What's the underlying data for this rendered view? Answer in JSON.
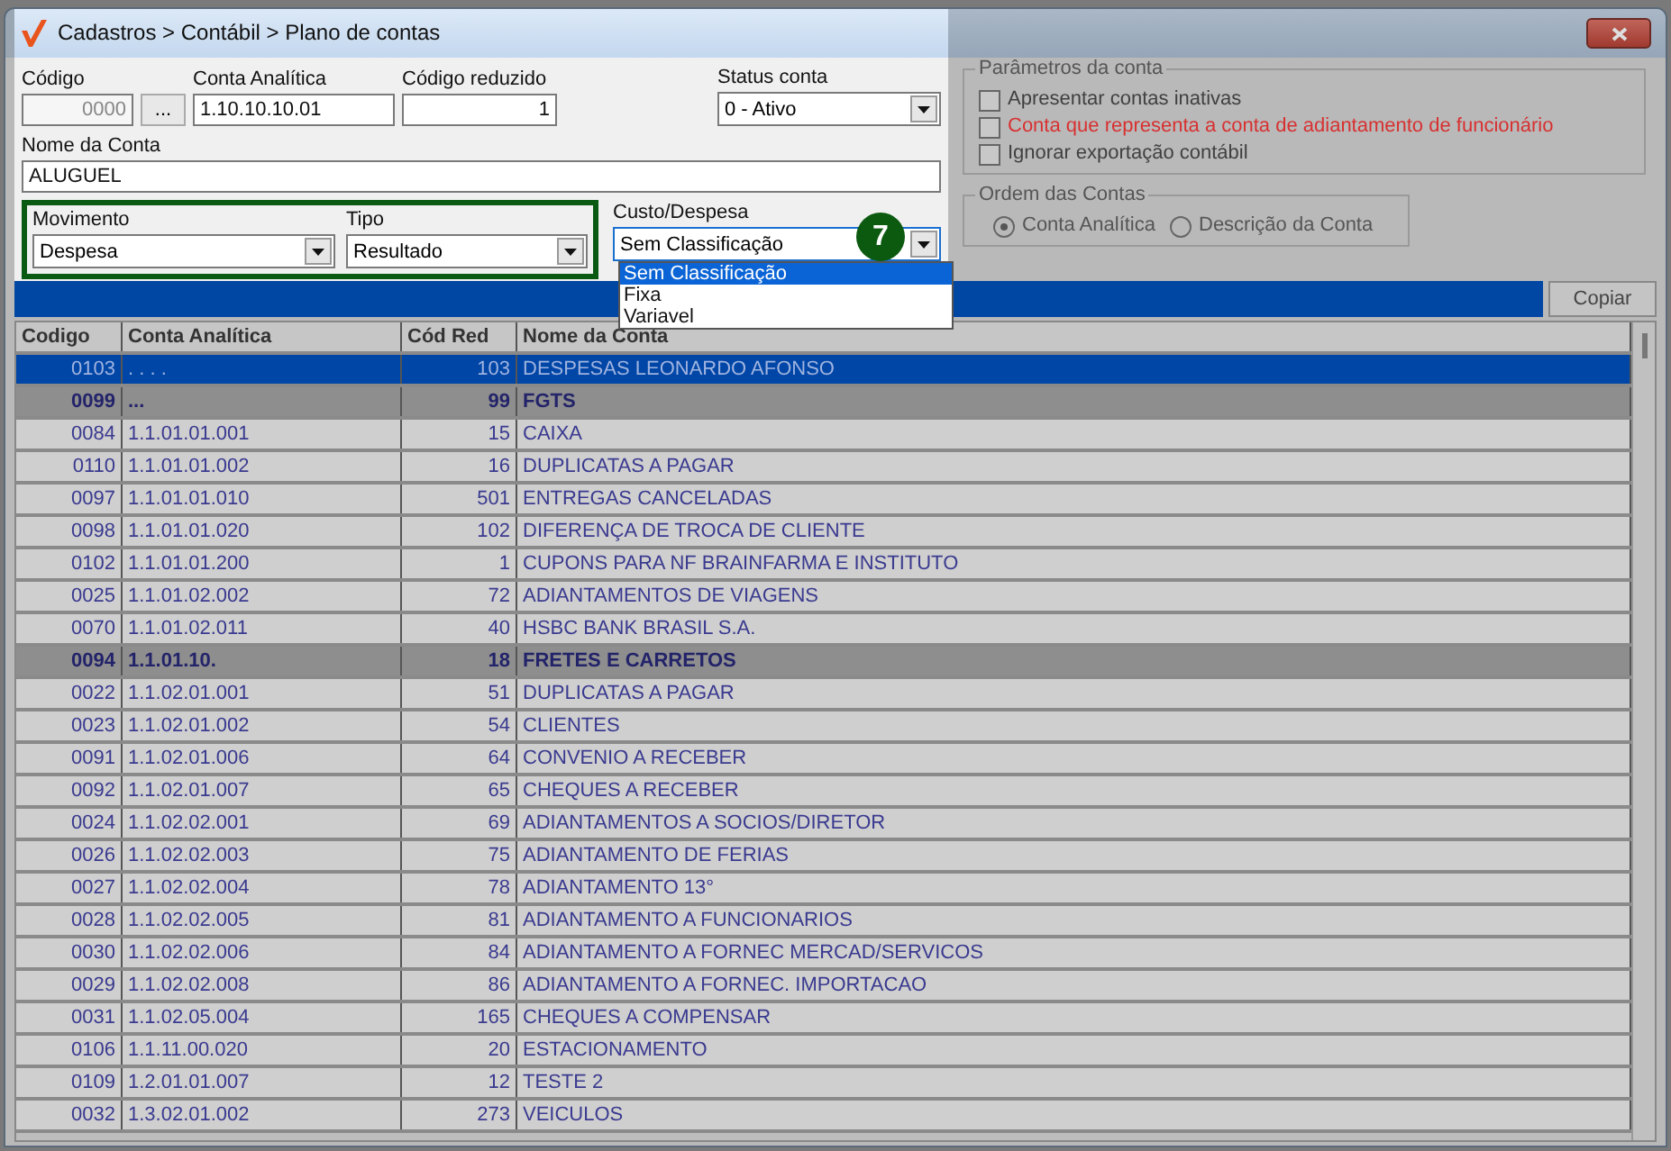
{
  "window": {
    "title": "Cadastros > Contábil > Plano de contas"
  },
  "form": {
    "codigo": {
      "label": "Código",
      "value": "0000",
      "disabled": true,
      "lookup_button": "..."
    },
    "conta_analitica": {
      "label": "Conta Analítica",
      "value": "1.10.10.10.01"
    },
    "codigo_reduzido": {
      "label": "Código reduzido",
      "value": "1"
    },
    "status_conta": {
      "label": "Status conta",
      "value": "0 - Ativo"
    },
    "nome_da_conta": {
      "label": "Nome da Conta",
      "value": "ALUGUEL"
    },
    "movimento": {
      "label": "Movimento",
      "value": "Despesa"
    },
    "tipo": {
      "label": "Tipo",
      "value": "Resultado"
    },
    "custo_despesa": {
      "label": "Custo/Despesa",
      "value": "Sem Classificação",
      "expanded": true,
      "options": [
        {
          "label": "Sem Classificação",
          "selected": true
        },
        {
          "label": "Fixa",
          "selected": false
        },
        {
          "label": "Variavel",
          "selected": false
        }
      ]
    }
  },
  "callout": "7",
  "parametros": {
    "title": "Parâmetros da conta",
    "options": [
      {
        "label": "Apresentar contas inativas",
        "checked": false,
        "color": "#404040"
      },
      {
        "label": "Conta que representa a conta de adiantamento de funcionário",
        "checked": false,
        "color": "#d83030"
      },
      {
        "label": "Ignorar exportação contábil",
        "checked": false,
        "color": "#404040"
      }
    ]
  },
  "ordem": {
    "title": "Ordem das Contas",
    "options": [
      {
        "label": "Conta Analítica",
        "selected": true
      },
      {
        "label": "Descrição da Conta",
        "selected": false
      }
    ]
  },
  "copy_button": "Copiar",
  "table": {
    "columns": [
      "Codigo",
      "Conta Analítica",
      "Cód Red",
      "Nome da Conta"
    ],
    "rows": [
      {
        "kind": "account",
        "selected": true,
        "cells": [
          "0103",
          ". . . .",
          "103",
          "DESPESAS LEONARDO AFONSO"
        ]
      },
      {
        "kind": "group",
        "selected": false,
        "cells": [
          "0099",
          "...",
          "99",
          "FGTS"
        ]
      },
      {
        "kind": "account",
        "selected": false,
        "cells": [
          "0084",
          "1.1.01.01.001",
          "15",
          "CAIXA"
        ]
      },
      {
        "kind": "account",
        "selected": false,
        "cells": [
          "0110",
          "1.1.01.01.002",
          "16",
          "DUPLICATAS A PAGAR"
        ]
      },
      {
        "kind": "account",
        "selected": false,
        "cells": [
          "0097",
          "1.1.01.01.010",
          "501",
          "ENTREGAS CANCELADAS"
        ]
      },
      {
        "kind": "account",
        "selected": false,
        "cells": [
          "0098",
          "1.1.01.01.020",
          "102",
          "DIFERENÇA DE TROCA DE CLIENTE"
        ]
      },
      {
        "kind": "account",
        "selected": false,
        "cells": [
          "0102",
          "1.1.01.01.200",
          "1",
          "CUPONS PARA NF BRAINFARMA E INSTITUTO"
        ]
      },
      {
        "kind": "account",
        "selected": false,
        "cells": [
          "0025",
          "1.1.01.02.002",
          "72",
          "ADIANTAMENTOS DE VIAGENS"
        ]
      },
      {
        "kind": "account",
        "selected": false,
        "cells": [
          "0070",
          "1.1.01.02.011",
          "40",
          "HSBC BANK BRASIL S.A."
        ]
      },
      {
        "kind": "group",
        "selected": false,
        "cells": [
          "0094",
          "1.1.01.10.",
          "18",
          "FRETES E CARRETOS"
        ]
      },
      {
        "kind": "account",
        "selected": false,
        "cells": [
          "0022",
          "1.1.02.01.001",
          "51",
          "DUPLICATAS A PAGAR"
        ]
      },
      {
        "kind": "account",
        "selected": false,
        "cells": [
          "0023",
          "1.1.02.01.002",
          "54",
          "CLIENTES"
        ]
      },
      {
        "kind": "account",
        "selected": false,
        "cells": [
          "0091",
          "1.1.02.01.006",
          "64",
          "CONVENIO A RECEBER"
        ]
      },
      {
        "kind": "account",
        "selected": false,
        "cells": [
          "0092",
          "1.1.02.01.007",
          "65",
          "CHEQUES A RECEBER"
        ]
      },
      {
        "kind": "account",
        "selected": false,
        "cells": [
          "0024",
          "1.1.02.02.001",
          "69",
          "ADIANTAMENTOS A SOCIOS/DIRETOR"
        ]
      },
      {
        "kind": "account",
        "selected": false,
        "cells": [
          "0026",
          "1.1.02.02.003",
          "75",
          "ADIANTAMENTO DE FERIAS"
        ]
      },
      {
        "kind": "account",
        "selected": false,
        "cells": [
          "0027",
          "1.1.02.02.004",
          "78",
          "ADIANTAMENTO 13°"
        ]
      },
      {
        "kind": "account",
        "selected": false,
        "cells": [
          "0028",
          "1.1.02.02.005",
          "81",
          "ADIANTAMENTO A FUNCIONARIOS"
        ]
      },
      {
        "kind": "account",
        "selected": false,
        "cells": [
          "0030",
          "1.1.02.02.006",
          "84",
          "ADIANTAMENTO A FORNEC MERCAD/SERVICOS"
        ]
      },
      {
        "kind": "account",
        "selected": false,
        "cells": [
          "0029",
          "1.1.02.02.008",
          "86",
          "ADIANTAMENTO A FORNEC. IMPORTACAO"
        ]
      },
      {
        "kind": "account",
        "selected": false,
        "cells": [
          "0031",
          "1.1.02.05.004",
          "165",
          "CHEQUES A COMPENSAR"
        ]
      },
      {
        "kind": "account",
        "selected": false,
        "cells": [
          "0106",
          "1.1.11.00.020",
          "20",
          "ESTACIONAMENTO"
        ]
      },
      {
        "kind": "account",
        "selected": false,
        "cells": [
          "0109",
          "1.2.01.01.007",
          "12",
          "TESTE 2"
        ]
      },
      {
        "kind": "account",
        "selected": false,
        "cells": [
          "0032",
          "1.3.02.01.002",
          "273",
          "VEICULOS"
        ]
      }
    ]
  }
}
